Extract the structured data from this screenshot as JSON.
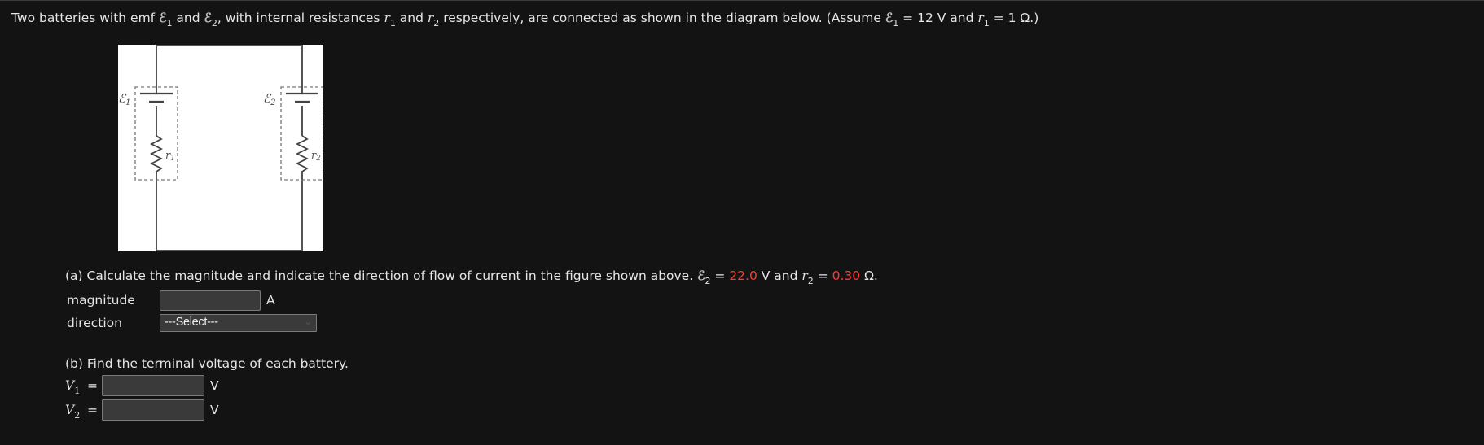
{
  "intro": {
    "t1": "Two batteries with emf ",
    "emf_symbol": "ℰ",
    "sub1": "1",
    "t2": " and ",
    "sub2": "2",
    "t3": ", with internal resistances ",
    "r": "r",
    "t4": " and ",
    "t5": " respectively, are connected as shown in the diagram below. (Assume ",
    "t6": " = 12 V and ",
    "t7": " = 1 Ω.)"
  },
  "figure": {
    "emf1_label": "ℰ",
    "emf1_sub": "1",
    "emf2_label": "ℰ",
    "emf2_sub": "2",
    "r1_label": "r",
    "r1_sub": "1",
    "r2_label": "r",
    "r2_sub": "2"
  },
  "part_a": {
    "text": "(a) Calculate the magnitude and indicate the direction of flow of current in the figure shown above. ",
    "eq1": " = ",
    "emf2_value": "22.0",
    "t_mid": " V and ",
    "eq2": " = ",
    "r2_value": "0.30",
    "t_end": " Ω.",
    "highlight_color": "#ff3b2f",
    "magnitude_label": "magnitude",
    "magnitude_value": "",
    "magnitude_unit": "A",
    "direction_label": "direction",
    "direction_selected": "---Select---"
  },
  "part_b": {
    "text": "(b) Find the terminal voltage of each battery.",
    "v": "V",
    "v1_sub": "1",
    "v2_sub": "2",
    "eq": "=",
    "v1_value": "",
    "v2_value": "",
    "unit": "V"
  }
}
